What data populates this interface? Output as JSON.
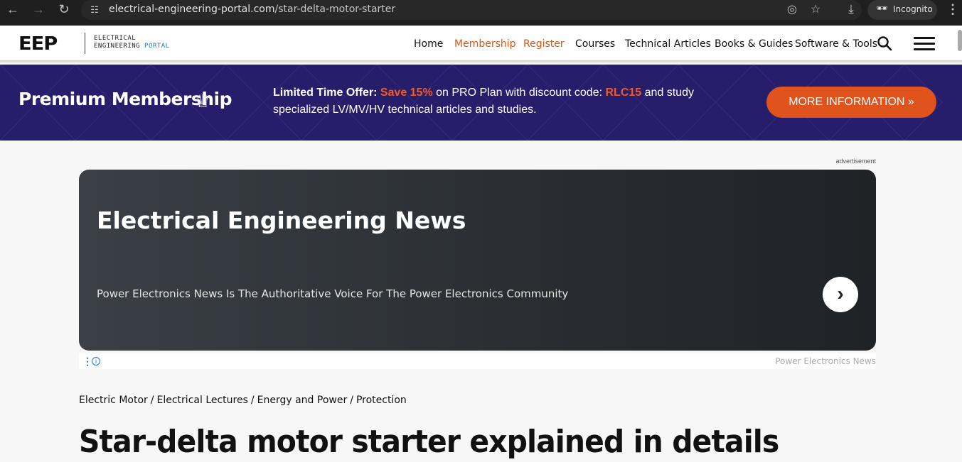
{
  "browser": {
    "url_host": "electrical-engineering-portal.com",
    "url_path": "/star-delta-motor-starter",
    "incognito_label": "Incognito",
    "icons": [
      "back-icon",
      "forward-icon",
      "reload-icon",
      "site-info-icon",
      "eye-off-icon",
      "star-icon",
      "download-icon",
      "incognito-icon",
      "kebab-menu-icon"
    ]
  },
  "site": {
    "logo_letters": "EEP",
    "logo_line1": "ELECTRICAL",
    "logo_line2a": "ENGINEERING ",
    "logo_line2b": "PORTAL",
    "nav": [
      "Home",
      "Membership",
      "Register",
      "Courses",
      "Technical Articles",
      "Books & Guides",
      "Software & Tools"
    ],
    "accent_color": "#cf5a17"
  },
  "banner": {
    "title": "Premium Membership",
    "crown": "♕",
    "offer_lead": "Limited Time Offer:",
    "offer_save": "Save 15%",
    "offer_mid": "on PRO Plan with discount code:",
    "offer_code": "RLC15",
    "offer_tail": "and study specialized LV/MV/HV technical articles and studies.",
    "button": "MORE INFORMATION »",
    "bg_color": "#271e6b",
    "button_color": "#e0531d"
  },
  "ad": {
    "label": "advertisement",
    "title": "Electrical Engineering News",
    "subtitle": "Power Electronics News Is The Authoritative Voice For The Power Electronics Community",
    "arrow": "›",
    "brand": "Power Electronics News",
    "info": "i",
    "dots": "⋮"
  },
  "article": {
    "categories": [
      "Electric Motor",
      "Electrical Lectures",
      "Energy and Power",
      "Protection"
    ],
    "title": "Star-delta motor starter explained in details"
  }
}
